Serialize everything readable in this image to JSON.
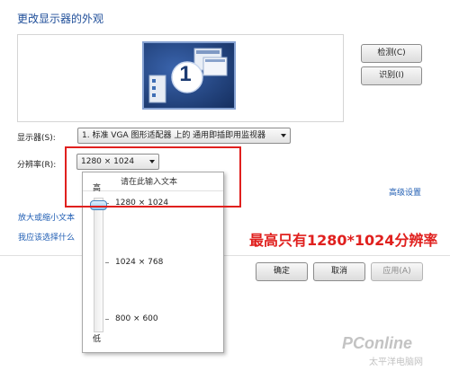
{
  "header": {
    "title": "更改显示器的外观"
  },
  "preview": {
    "monitor_number": "1",
    "detect_button": "检测(C)",
    "identify_button": "识别(I)"
  },
  "settings": {
    "display_label": "显示器(S):",
    "display_value": "1. 标准 VGA 图形适配器 上的 通用即插即用监视器",
    "resolution_label": "分辨率(R):",
    "resolution_value": "1280 × 1024",
    "advanced_link": "高级设置"
  },
  "links": {
    "text_size": "放大或缩小文本",
    "help": "我应该选择什么"
  },
  "resolution_popup": {
    "input_placeholder": "请在此输入文本",
    "high_label": "高",
    "low_label": "低",
    "options": [
      "1280 × 1024",
      "1024 × 768",
      "800 × 600"
    ],
    "slider_position": 0
  },
  "annotation": {
    "text": "最高只有1280*1024分辨率",
    "color": "#e0201e"
  },
  "footer": {
    "ok": "确定",
    "cancel": "取消",
    "apply": "应用(A)"
  },
  "watermark": {
    "brand": "PConline",
    "sub": "太平洋电脑网"
  },
  "colors": {
    "title": "#1f4e99",
    "link": "#1f5db3",
    "monitor_bg": "#1c3b72"
  }
}
